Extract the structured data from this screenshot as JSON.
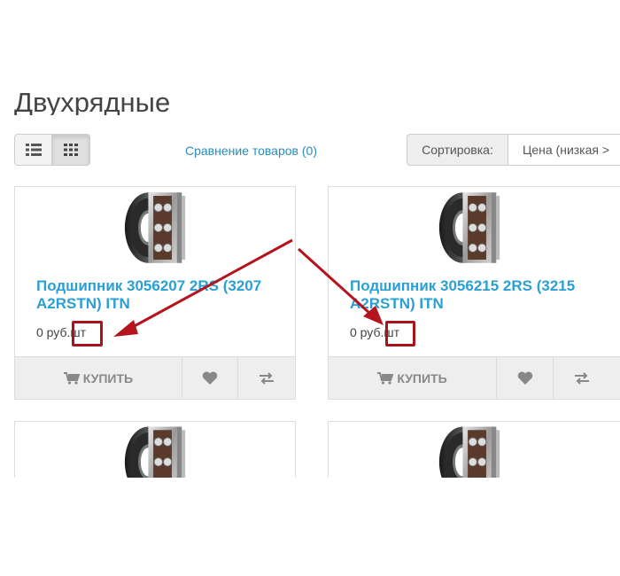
{
  "page": {
    "title": "Двухрядные",
    "compare_link": "Сравнение товаров (0)"
  },
  "view_toggle": {
    "list_icon": "list-icon",
    "grid_icon": "grid-icon"
  },
  "sort": {
    "label": "Сортировка:",
    "selected": "Цена (низкая > "
  },
  "products": [
    {
      "name": "Подшипник 3056207 2RS (3207 A2RSTN) ITN",
      "price": "0 руб.",
      "unit": "шт",
      "cart_label": "КУПИТЬ",
      "cart_icon": "shopping-cart-icon",
      "wish_icon": "heart-icon",
      "compare_icon": "exchange-icon"
    },
    {
      "name": "Подшипник 3056215 2RS (3215 A2RSTN) ITN",
      "price": "0 руб.",
      "unit": "шт",
      "cart_label": "КУПИТЬ",
      "cart_icon": "shopping-cart-icon",
      "wish_icon": "heart-icon",
      "compare_icon": "exchange-icon"
    }
  ],
  "annotation": {
    "color": "#a8141c",
    "arrow_color": "#b3141e"
  },
  "colors": {
    "link": "#2a9fd6",
    "compare_link": "#2a8bb7",
    "button_bg": "#eeeeee"
  }
}
